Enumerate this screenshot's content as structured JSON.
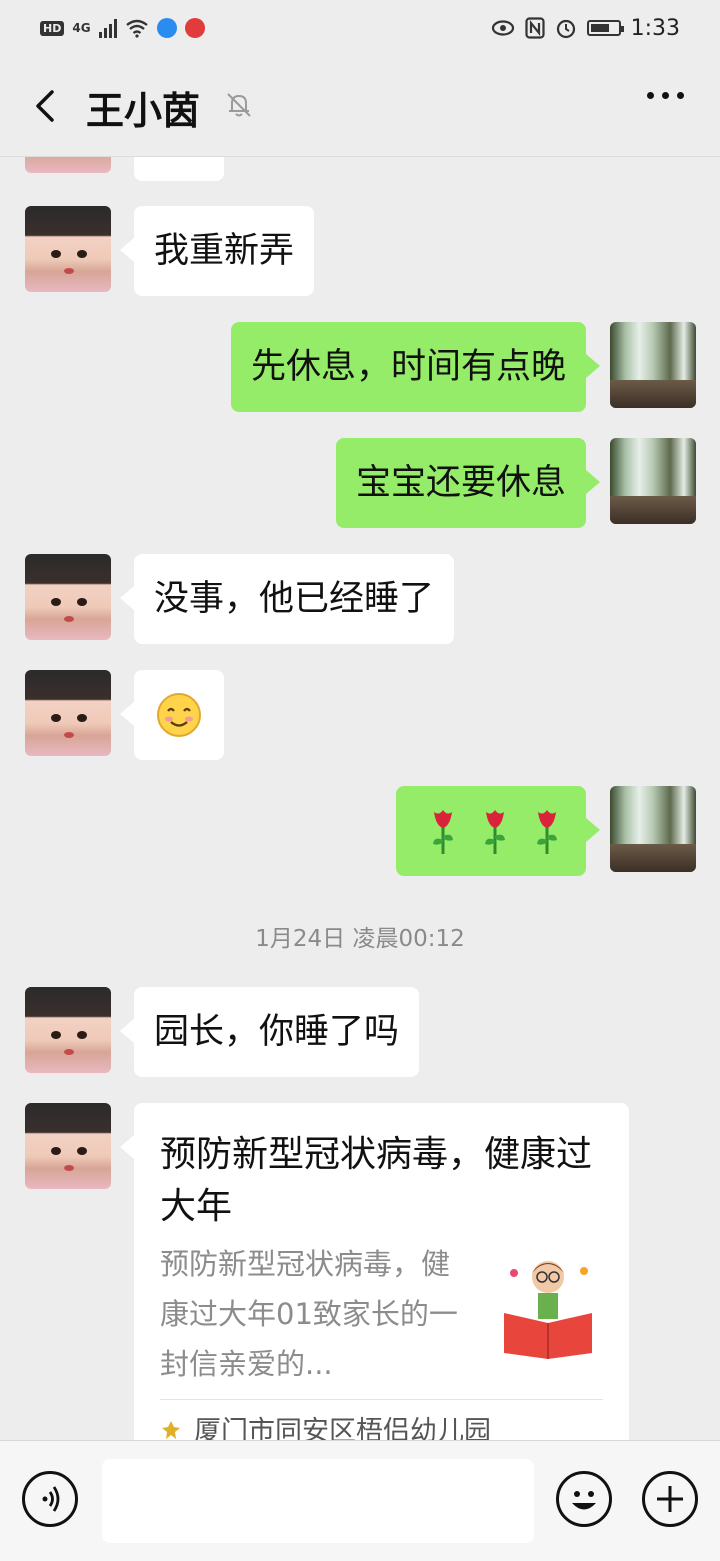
{
  "status_bar": {
    "hd": "HD",
    "network": "4G",
    "time": "1:33"
  },
  "header": {
    "title": "王小茵",
    "muted_icon": "bell-off-icon",
    "more_icon": "more-dots-icon"
  },
  "messages": [
    {
      "side": "left",
      "text": "我重新弄"
    },
    {
      "side": "right",
      "text": "先休息，时间有点晚"
    },
    {
      "side": "right",
      "text": "宝宝还要休息"
    },
    {
      "side": "left",
      "text": "没事，他已经睡了"
    },
    {
      "side": "left",
      "emoji": "smiley"
    },
    {
      "side": "right",
      "emoji": "roses",
      "count": 3
    },
    {
      "side": "left",
      "text": "园长，你睡了吗"
    }
  ],
  "timestamp": "1月24日 凌晨00:12",
  "article_card": {
    "title": "预防新型冠状病毒，健康过大年",
    "description": "预防新型冠状病毒，健康过大年01致家长的一封信亲爱的...",
    "source": "厦门市同安区梧侣幼儿园"
  },
  "colors": {
    "background": "#ededed",
    "sent_bubble": "#95ec69",
    "received_bubble": "#ffffff"
  }
}
